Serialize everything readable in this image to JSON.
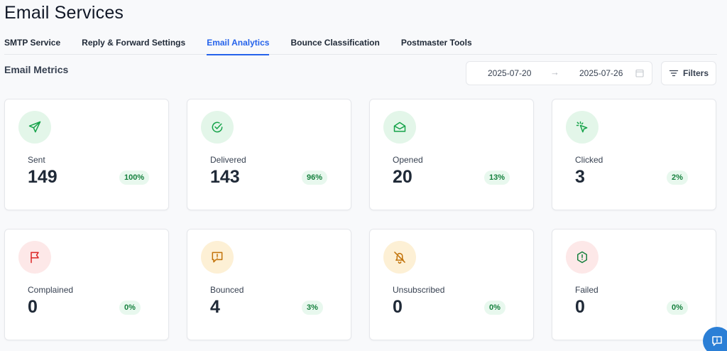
{
  "page": {
    "title": "Email Services"
  },
  "tabs": [
    {
      "label": "SMTP Service",
      "active": false
    },
    {
      "label": "Reply & Forward Settings",
      "active": false
    },
    {
      "label": "Email Analytics",
      "active": true
    },
    {
      "label": "Bounce Classification",
      "active": false
    },
    {
      "label": "Postmaster Tools",
      "active": false
    }
  ],
  "section": {
    "title": "Email Metrics"
  },
  "date_range": {
    "start": "2025-07-20",
    "separator": "→",
    "end": "2025-07-26",
    "icon": "calendar-icon"
  },
  "filters": {
    "label": "Filters",
    "icon": "filter-lines-icon"
  },
  "metrics": [
    {
      "label": "Sent",
      "value": "149",
      "percent": "100%",
      "icon": "send-icon",
      "color": "#16a34a",
      "bg": "#e3f6e9"
    },
    {
      "label": "Delivered",
      "value": "143",
      "percent": "96%",
      "icon": "check-circle-icon",
      "color": "#16a34a",
      "bg": "#e3f6e9"
    },
    {
      "label": "Opened",
      "value": "20",
      "percent": "13%",
      "icon": "envelope-open-icon",
      "color": "#16a34a",
      "bg": "#e3f6e9"
    },
    {
      "label": "Clicked",
      "value": "3",
      "percent": "2%",
      "icon": "cursor-click-icon",
      "color": "#16a34a",
      "bg": "#e3f6e9"
    },
    {
      "label": "Complained",
      "value": "0",
      "percent": "0%",
      "icon": "flag-icon",
      "color": "#dc2626",
      "bg": "#fde8e8"
    },
    {
      "label": "Bounced",
      "value": "4",
      "percent": "3%",
      "icon": "message-alert-icon",
      "color": "#c2730a",
      "bg": "#fdf0d5"
    },
    {
      "label": "Unsubscribed",
      "value": "0",
      "percent": "0%",
      "icon": "bell-off-icon",
      "color": "#c2730a",
      "bg": "#fdf0d5"
    },
    {
      "label": "Failed",
      "value": "0",
      "percent": "0%",
      "icon": "octagon-alert-icon",
      "color": "#15803d",
      "bg": "#fde8e8"
    }
  ],
  "help": {
    "icon": "help-chat-icon"
  }
}
